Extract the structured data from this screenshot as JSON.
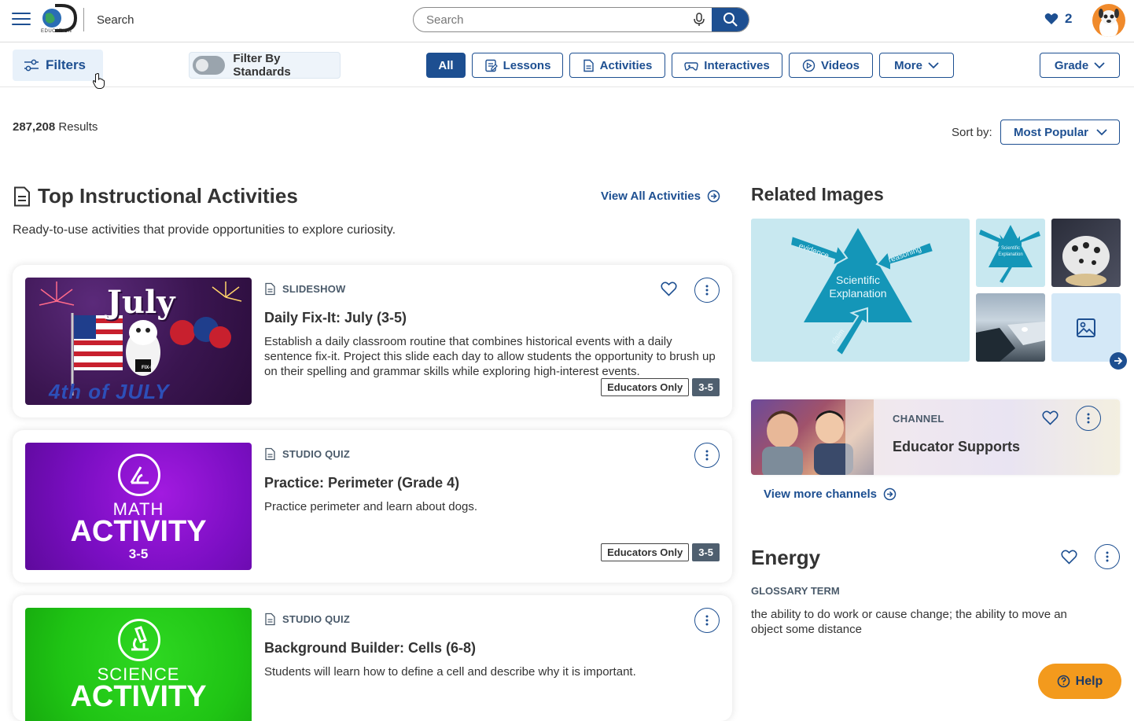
{
  "header": {
    "logo_text": "EDUCATION",
    "page_label": "Search",
    "search_placeholder": "Search",
    "favorites_count": "2"
  },
  "filterbar": {
    "filters_label": "Filters",
    "standards_label": "Filter By Standards",
    "chips": [
      "All",
      "Lessons",
      "Activities",
      "Interactives",
      "Videos",
      "More"
    ],
    "grade_label": "Grade"
  },
  "results": {
    "count": "287,208",
    "suffix": " Results",
    "sort_label": "Sort by:",
    "sort_value": "Most Popular"
  },
  "activities_section": {
    "title": "Top Instructional Activities",
    "view_all": "View All Activities",
    "description": "Ready-to-use activities that provide opportunities to explore curiosity.",
    "cards": [
      {
        "type": "SLIDESHOW",
        "title": "Daily Fix-It: July (3-5)",
        "description": "Establish a daily classroom routine that combines historical events with a daily sentence fix-it. Project this slide each day to allow students the opportunity to brush up on their spelling and grammar skills while exploring high-interest events.",
        "badge": "Educators Only",
        "grade": "3-5",
        "thumb_title": "July",
        "thumb_sub": "4th of JULY",
        "thumb_tag": "FIX-IT"
      },
      {
        "type": "STUDIO QUIZ",
        "title": "Practice: Perimeter (Grade 4)",
        "description": "Practice perimeter and learn about dogs.",
        "badge": "Educators Only",
        "grade": "3-5",
        "thumb_subject": "MATH",
        "thumb_word": "ACTIVITY",
        "thumb_grade": "3-5"
      },
      {
        "type": "STUDIO QUIZ",
        "title": "Background Builder: Cells (6-8)",
        "description": "Students will learn how to define a cell and describe why it is important.",
        "thumb_subject": "SCIENCE",
        "thumb_word": "ACTIVITY"
      }
    ]
  },
  "related_images": {
    "title": "Related Images",
    "diagram_center": "Scientific Explanation",
    "diagram_arrows": [
      "evidence",
      "reasoning",
      "claim"
    ],
    "small_diagram_text": "Scientific Explanation"
  },
  "channel": {
    "label": "CHANNEL",
    "title": "Educator Supports",
    "view_more": "View more channels"
  },
  "glossary": {
    "term": "Energy",
    "label": "GLOSSARY TERM",
    "definition": "the ability to do work or cause change; the ability to move an object some distance"
  },
  "help": {
    "label": "Help"
  },
  "colors": {
    "brand_blue": "#1d4f91",
    "help_orange": "#f39a1d",
    "grade_badge": "#4f5f6f",
    "toggle_off": "#9aa4ad"
  },
  "icons": [
    "menu-icon",
    "microphone-icon",
    "search-icon",
    "heart-icon",
    "filters-icon",
    "lesson-icon",
    "activity-icon",
    "interactive-icon",
    "video-icon",
    "chevron-down-icon",
    "document-icon",
    "arrow-right-circle-icon",
    "more-vertical-icon",
    "image-icon",
    "help-icon"
  ]
}
